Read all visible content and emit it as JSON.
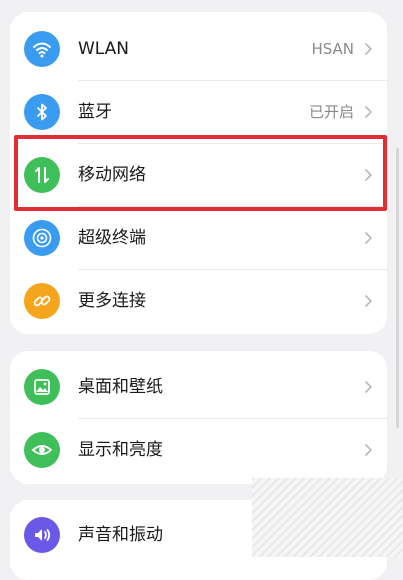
{
  "settings": {
    "group1": [
      {
        "label": "WLAN",
        "value": "HSAN",
        "icon": "wifi-icon",
        "color": "#3a9cf0"
      },
      {
        "label": "蓝牙",
        "value": "已开启",
        "icon": "bluetooth-icon",
        "color": "#3a9cf0"
      },
      {
        "label": "移动网络",
        "value": "",
        "icon": "mobile-data-icon",
        "color": "#3fbf5a"
      },
      {
        "label": "超级终端",
        "value": "",
        "icon": "super-device-icon",
        "color": "#3a9cf0"
      },
      {
        "label": "更多连接",
        "value": "",
        "icon": "link-icon",
        "color": "#f4a51c"
      }
    ],
    "group2": [
      {
        "label": "桌面和壁纸",
        "icon": "wallpaper-icon",
        "color": "#3fbf5a"
      },
      {
        "label": "显示和亮度",
        "icon": "eye-icon",
        "color": "#3fbf5a"
      }
    ],
    "group3": [
      {
        "label": "声音和振动",
        "icon": "sound-icon",
        "color": "#6b58e8"
      }
    ]
  },
  "highlight": {
    "color": "#e02d36",
    "target": "移动网络"
  }
}
